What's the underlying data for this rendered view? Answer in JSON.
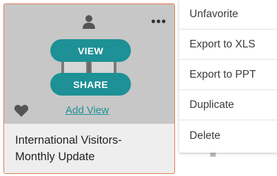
{
  "card": {
    "title_line1": "International Visitors-",
    "title_line2": "Monthly Update",
    "view_label": "VIEW",
    "share_label": "SHARE",
    "add_view_label": "Add View"
  },
  "menu": {
    "items": [
      {
        "label": "Unfavorite"
      },
      {
        "label": "Export to XLS"
      },
      {
        "label": "Export to PPT"
      },
      {
        "label": "Duplicate"
      },
      {
        "label": "Delete"
      }
    ]
  },
  "icons": {
    "owner": "user-icon",
    "more": "more-options-icon",
    "favorite": "heart-icon",
    "thumbnail": "book-icon"
  },
  "colors": {
    "accent": "#1d9196",
    "card_border": "#e07b52",
    "thumbnail_bg": "#c7c7c7",
    "card_bg": "#efeeee"
  }
}
